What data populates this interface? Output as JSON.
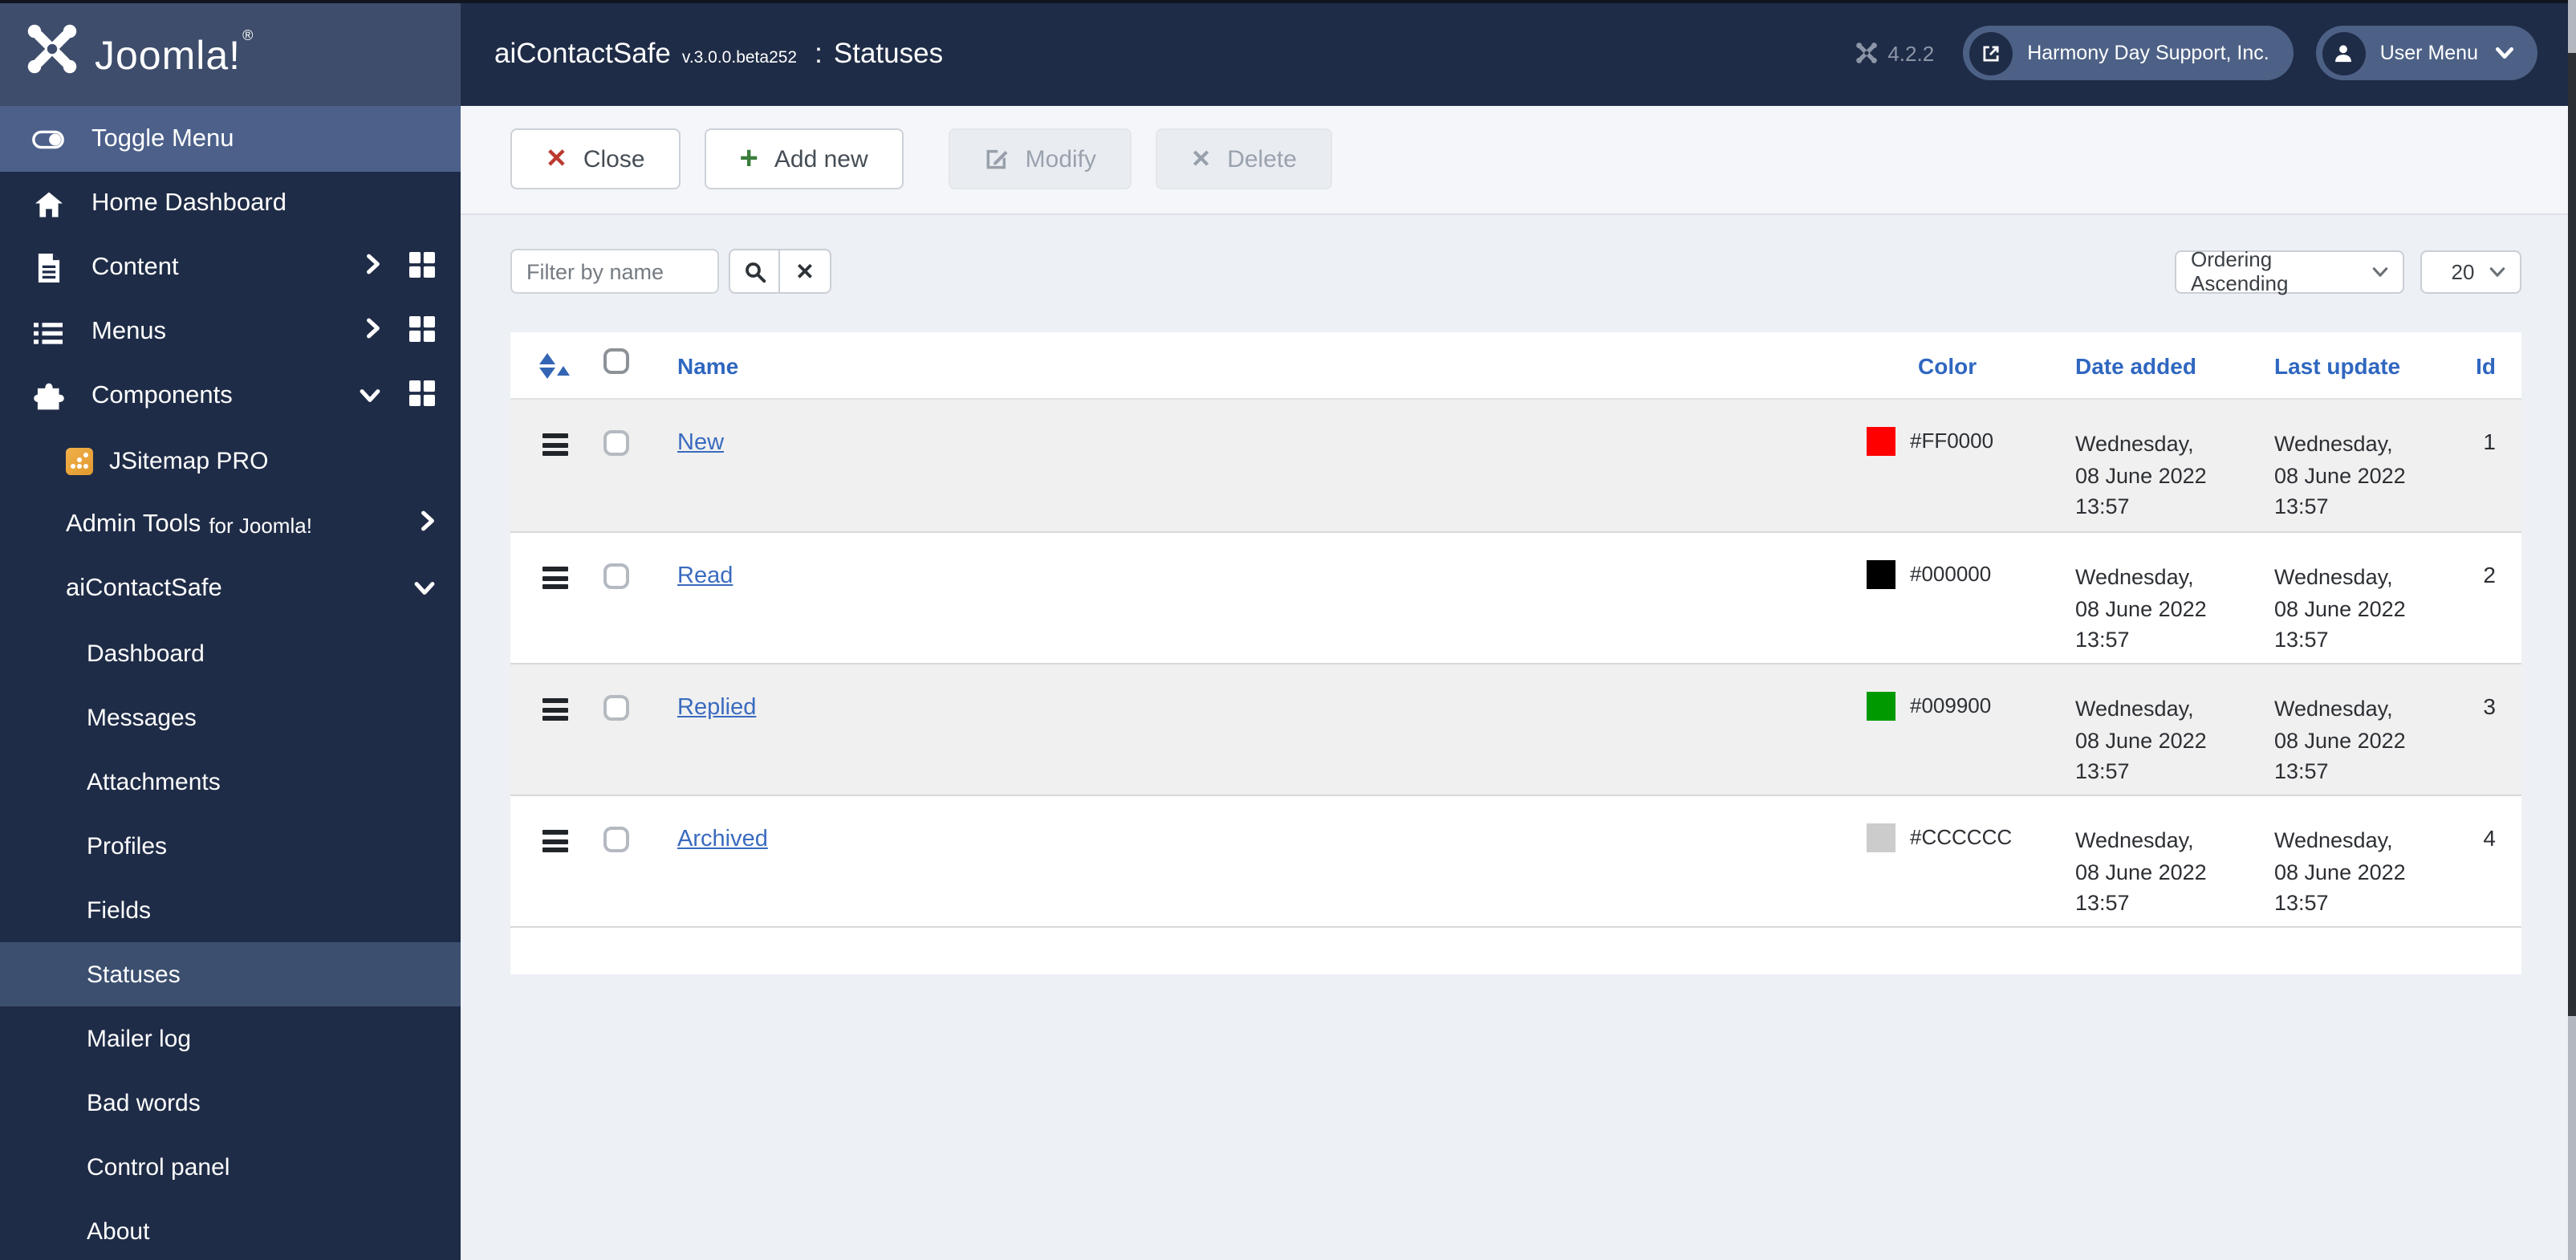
{
  "header": {
    "brand": "Joomla!",
    "registered_mark": "®",
    "component_title": "aiContactSafe",
    "component_version": "v.3.0.0.beta252",
    "separator": ":",
    "page_title": "Statuses",
    "joomla_version": "4.2.2",
    "site_button_label": "Harmony Day Support, Inc.",
    "user_menu_label": "User Menu"
  },
  "sidebar": {
    "items": [
      {
        "label": "Toggle Menu"
      },
      {
        "label": "Home Dashboard"
      },
      {
        "label": "Content"
      },
      {
        "label": "Menus"
      },
      {
        "label": "Components"
      },
      {
        "label": "JSitemap PRO"
      },
      {
        "label": "Admin Tools",
        "suffix": "for Joomla!"
      },
      {
        "label": "aiContactSafe"
      },
      {
        "label": "Dashboard"
      },
      {
        "label": "Messages"
      },
      {
        "label": "Attachments"
      },
      {
        "label": "Profiles"
      },
      {
        "label": "Fields"
      },
      {
        "label": "Statuses"
      },
      {
        "label": "Mailer log"
      },
      {
        "label": "Bad words"
      },
      {
        "label": "Control panel"
      },
      {
        "label": "About"
      }
    ]
  },
  "toolbar": {
    "close_label": "Close",
    "add_new_label": "Add new",
    "modify_label": "Modify",
    "delete_label": "Delete"
  },
  "filters": {
    "filter_placeholder": "Filter by name",
    "ordering_value": "Ordering Ascending",
    "page_size_value": "20"
  },
  "table": {
    "headers": {
      "name": "Name",
      "color": "Color",
      "date_added": "Date added",
      "last_update": "Last update",
      "id": "Id"
    },
    "rows": [
      {
        "name": "New",
        "color_hex": "#FF0000",
        "date_added": "Wednesday, 08 June 2022 13:57",
        "last_update": "Wednesday, 08 June 2022 13:57",
        "id": "1"
      },
      {
        "name": "Read",
        "color_hex": "#000000",
        "date_added": "Wednesday, 08 June 2022 13:57",
        "last_update": "Wednesday, 08 June 2022 13:57",
        "id": "2"
      },
      {
        "name": "Replied",
        "color_hex": "#009900",
        "date_added": "Wednesday, 08 June 2022 13:57",
        "last_update": "Wednesday, 08 June 2022 13:57",
        "id": "3"
      },
      {
        "name": "Archived",
        "color_hex": "#CCCCCC",
        "date_added": "Wednesday, 08 June 2022 13:57",
        "last_update": "Wednesday, 08 June 2022 13:57",
        "id": "4"
      }
    ]
  },
  "colors": {
    "header_bg": "#1f2c47",
    "sidebar_selected_bg": "#3c4f6f",
    "accent_link_blue": "#3a6bbf",
    "table_header_blue": "#2f67c0",
    "close_icon_red": "#bb3a30",
    "add_icon_green": "#3b7d3c"
  }
}
